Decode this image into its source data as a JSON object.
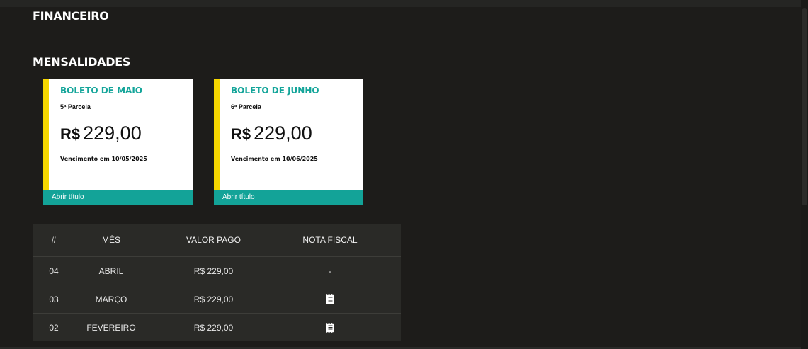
{
  "page": {
    "title": "FINANCEIRO",
    "section_title": "MENSALIDADES"
  },
  "cards": [
    {
      "title": "BOLETO DE MAIO",
      "parcela": "5ª Parcela",
      "currency": "R$",
      "amount": "229,00",
      "vencimento": "Vencimento em 10/05/2025",
      "action": "Abrir título"
    },
    {
      "title": "BOLETO DE JUNHO",
      "parcela": "6ª Parcela",
      "currency": "R$",
      "amount": "229,00",
      "vencimento": "Vencimento em 10/06/2025",
      "action": "Abrir título"
    }
  ],
  "table": {
    "headers": [
      "#",
      "MÊS",
      "VALOR PAGO",
      "NOTA FISCAL"
    ],
    "rows": [
      {
        "num": "04",
        "mes": "ABRIL",
        "valor": "R$ 229,00",
        "nota": "-"
      },
      {
        "num": "03",
        "mes": "MARÇO",
        "valor": "R$ 229,00",
        "nota": "receipt-icon"
      },
      {
        "num": "02",
        "mes": "FEVEREIRO",
        "valor": "R$ 229,00",
        "nota": "receipt-icon"
      }
    ]
  },
  "colors": {
    "accent": "#13a398",
    "highlight": "#f5d600",
    "background": "#1d1c1a"
  }
}
